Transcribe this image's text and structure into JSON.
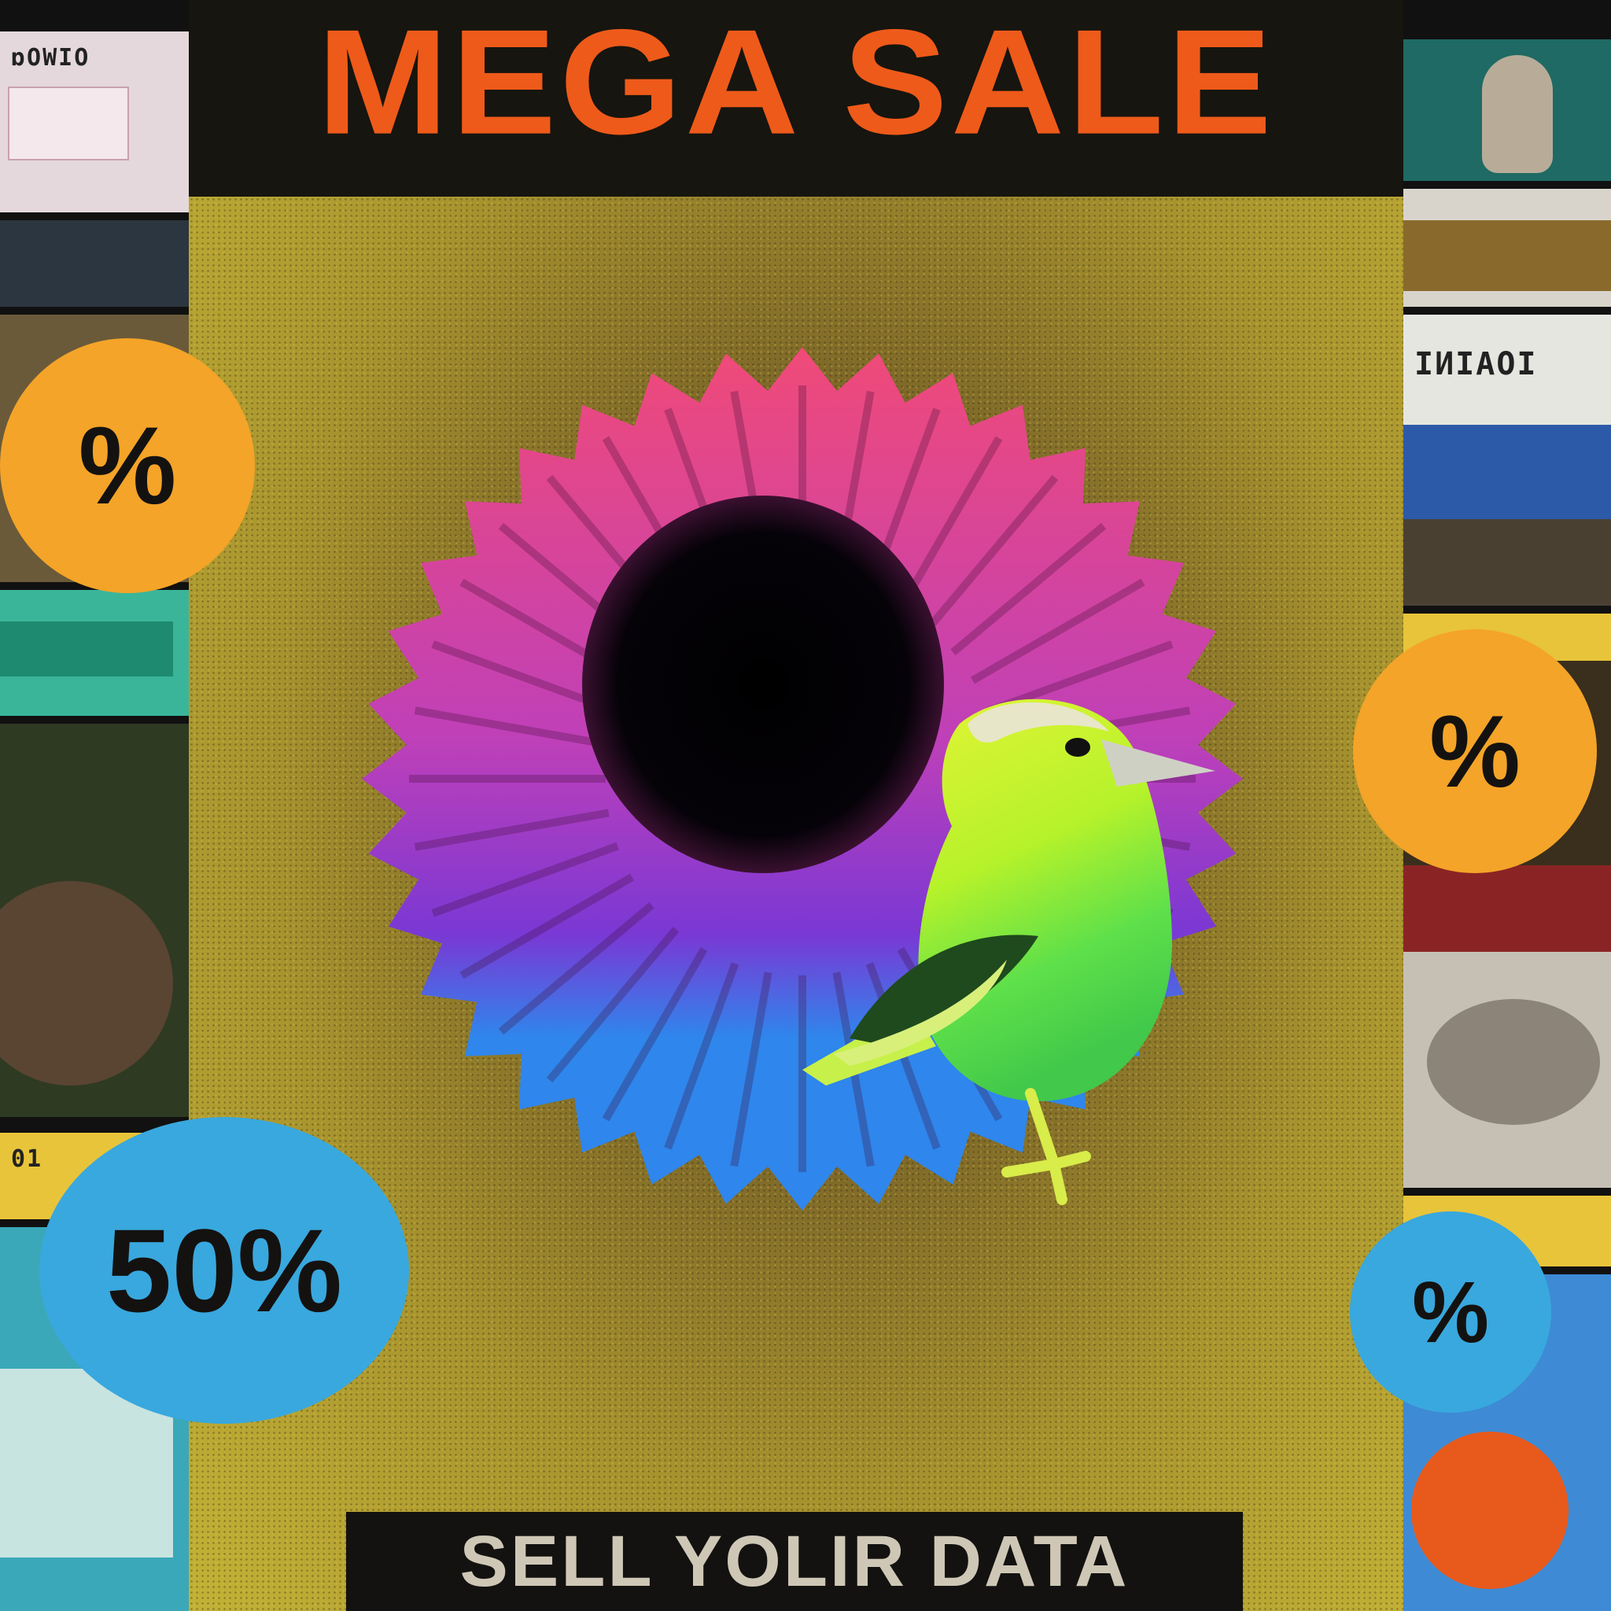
{
  "poster": {
    "headline": "MEGA SALE",
    "footer": "SELL YOLIR DATA"
  },
  "badges": [
    {
      "name": "percent-badge-left-orange",
      "label": "%",
      "color": "#f4a428"
    },
    {
      "name": "percent-badge-right-orange",
      "label": "%",
      "color": "#f4a428"
    },
    {
      "name": "discount-badge-50",
      "label": "50%",
      "color": "#39a8de"
    },
    {
      "name": "percent-badge-right-blue",
      "label": "%",
      "color": "#39a8de"
    }
  ],
  "left_thumbnails": [
    {
      "text": "ɒOWIO",
      "color": "#e4d8dc"
    },
    {
      "text": "",
      "color": "#2c3640"
    },
    {
      "text": "",
      "color": "#d8c8b0"
    },
    {
      "text": "",
      "color": "#3ab59a"
    },
    {
      "text": "",
      "color": "#2e5a2a"
    },
    {
      "text": "01",
      "color": "#e8c43a"
    },
    {
      "text": "",
      "color": "#3aa8b8"
    }
  ],
  "right_thumbnails": [
    {
      "text": "",
      "color": "#1f6a64"
    },
    {
      "text": "",
      "color": "#8a6a2c"
    },
    {
      "text": "IИIAOI",
      "color": "#e6e6e0"
    },
    {
      "text": "",
      "color": "#2d5aa8"
    },
    {
      "text": "",
      "color": "#e8c43a"
    },
    {
      "text": "",
      "color": "#8a2424"
    },
    {
      "text": "",
      "color": "#c6c0b4"
    },
    {
      "text": "",
      "color": "#e8c43a"
    },
    {
      "text": "",
      "color": "#3e8ad4"
    }
  ],
  "colors": {
    "headline": "#ee5a1a",
    "poster_bg": "#a8942e",
    "burst_top": "#f04a78",
    "burst_mid": "#b43ad0",
    "burst_bottom": "#2f86ec",
    "bird_body": "#b6f22a",
    "bird_belly": "#5ee04a"
  }
}
